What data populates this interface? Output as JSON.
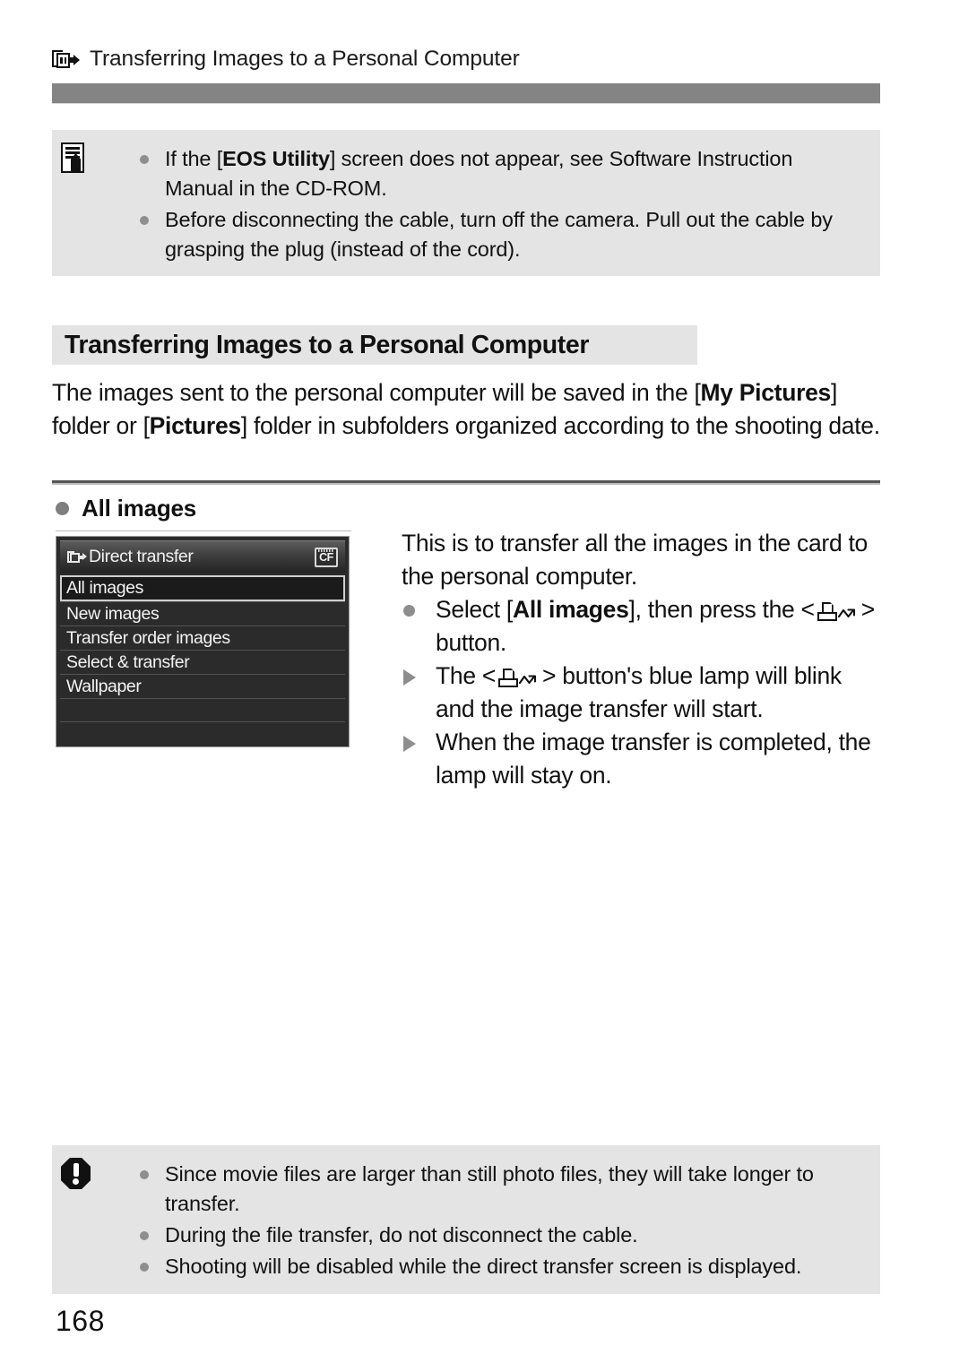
{
  "document": {
    "running_header": {
      "icon": "direct-transfer-icon",
      "title": "Transferring Images to a Personal Computer"
    },
    "page_number": "168"
  },
  "note_box_top": {
    "icon": "notes-icon",
    "items": [
      {
        "parts": [
          {
            "text": "If the [",
            "bold": false
          },
          {
            "text": "EOS Utility",
            "bold": true
          },
          {
            "text": "] screen does not appear, see Software Instruction Manual in the CD-ROM.",
            "bold": false
          }
        ]
      },
      {
        "parts": [
          {
            "text": "Before disconnecting the cable, turn off the camera. Pull out the cable by grasping the plug (instead of the cord).",
            "bold": false
          }
        ]
      }
    ]
  },
  "section": {
    "title": "Transferring Images to a Personal Computer",
    "intro_parts": [
      {
        "text": "The images sent to the personal computer will be saved in the [",
        "bold": false
      },
      {
        "text": "My Pictures",
        "bold": true
      },
      {
        "text": "] folder or [",
        "bold": false
      },
      {
        "text": "Pictures",
        "bold": true
      },
      {
        "text": "] folder in subfolders organized according to the shooting date.",
        "bold": false
      }
    ],
    "subheading": "All images"
  },
  "lcd_screen": {
    "header": {
      "icon": "direct-transfer-icon",
      "title": "Direct transfer",
      "card_badge": "CF"
    },
    "menu_items": [
      {
        "label": "All images",
        "selected": true
      },
      {
        "label": "New images",
        "selected": false
      },
      {
        "label": "Transfer order images",
        "selected": false
      },
      {
        "label": "Select & transfer",
        "selected": false
      },
      {
        "label": "Wallpaper",
        "selected": false
      }
    ],
    "empty_rows": 2
  },
  "instructions": {
    "lead": "This is to transfer all the images in the card to the personal computer.",
    "steps": [
      {
        "marker": "bullet",
        "parts": [
          {
            "text": "Select [",
            "bold": false
          },
          {
            "text": "All images",
            "bold": true
          },
          {
            "text": "], then press the <",
            "bold": false
          },
          {
            "text": "print-share-glyph",
            "glyph": true
          },
          {
            "text": "> button.",
            "bold": false
          }
        ]
      },
      {
        "marker": "triangle",
        "parts": [
          {
            "text": "The <",
            "bold": false
          },
          {
            "text": "print-share-glyph",
            "glyph": true
          },
          {
            "text": "> button's blue lamp will blink and the image transfer will start.",
            "bold": false
          }
        ]
      },
      {
        "marker": "triangle",
        "parts": [
          {
            "text": "When the image transfer is completed, the lamp will stay on.",
            "bold": false
          }
        ]
      }
    ]
  },
  "caution_box": {
    "icon": "caution-icon",
    "items": [
      {
        "text": "Since movie files are larger than still photo files, they will take longer to transfer."
      },
      {
        "text": "During the file transfer, do not disconnect the cable."
      },
      {
        "text": "Shooting will be disabled while the direct transfer screen is displayed."
      }
    ]
  },
  "colors": {
    "note_box_background": "#e4e4e4",
    "rule_bar": "#848484",
    "bullet_gray": "#8e8e8e",
    "lcd_background": "#2b2b2b"
  }
}
